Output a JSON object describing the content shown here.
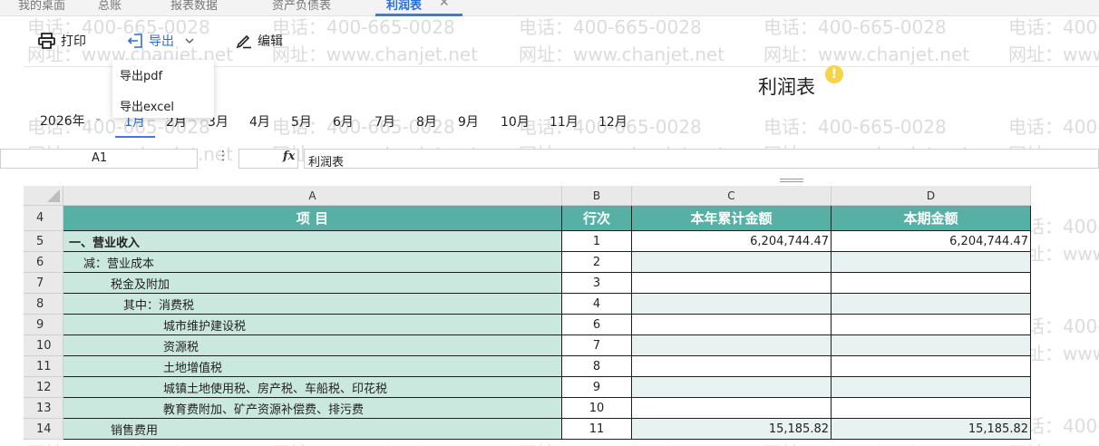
{
  "tabs": [
    {
      "label": "我的桌面",
      "active": false
    },
    {
      "label": "总账",
      "active": false
    },
    {
      "label": "报表数据",
      "active": false
    },
    {
      "label": "资产负债表",
      "active": false
    },
    {
      "label": "利润表",
      "active": true
    }
  ],
  "toolbar": {
    "print_label": "打印",
    "export_label": "导出",
    "edit_label": "编辑"
  },
  "export_menu": [
    "导出pdf",
    "导出excel"
  ],
  "report": {
    "title": "利润表",
    "warning_icon": "!"
  },
  "period": {
    "year": "2026年",
    "months": [
      "1月",
      "2月",
      "3月",
      "4月",
      "5月",
      "6月",
      "7月",
      "8月",
      "9月",
      "10月",
      "11月",
      "12月"
    ],
    "active_month": "1月"
  },
  "formula_bar": {
    "cell_ref": "A1",
    "content": "利润表",
    "fx_symbol": "fx"
  },
  "grid": {
    "columns": [
      "A",
      "B",
      "C",
      "D"
    ],
    "header_row": {
      "row": "4",
      "item": "项 目",
      "line_no": "行次",
      "ytd": "本年累计金额",
      "current": "本期金额"
    },
    "rows": [
      {
        "row": "5",
        "item": "一、营业收入",
        "line": "1",
        "ytd": "6,204,744.47",
        "current": "6,204,744.47"
      },
      {
        "row": "6",
        "item": "减：营业成本",
        "line": "2",
        "ytd": "",
        "current": ""
      },
      {
        "row": "7",
        "item": "税金及附加",
        "line": "3",
        "ytd": "",
        "current": ""
      },
      {
        "row": "8",
        "item": "其中：消费税",
        "line": "4",
        "ytd": "",
        "current": ""
      },
      {
        "row": "9",
        "item": "城市维护建设税",
        "line": "6",
        "ytd": "",
        "current": ""
      },
      {
        "row": "10",
        "item": "资源税",
        "line": "7",
        "ytd": "",
        "current": ""
      },
      {
        "row": "11",
        "item": "土地增值税",
        "line": "8",
        "ytd": "",
        "current": ""
      },
      {
        "row": "12",
        "item": "城镇土地使用税、房产税、车船税、印花税",
        "line": "9",
        "ytd": "",
        "current": ""
      },
      {
        "row": "13",
        "item": "教育费附加、矿产资源补偿费、排污费",
        "line": "10",
        "ytd": "",
        "current": ""
      },
      {
        "row": "14",
        "item": "销售费用",
        "line": "11",
        "ytd": "15,185.82",
        "current": "15,185.82"
      }
    ]
  },
  "watermark": {
    "phone": "电话：400-665-0028",
    "site": "网址：www.chanjet.net"
  },
  "colors": {
    "accent": "#2b6fd6",
    "header_teal": "#56b1a4",
    "item_green": "#cbe8de",
    "warning": "#f6d44a"
  },
  "icons": [
    "printer-icon",
    "export-icon",
    "chevron-down-icon",
    "edit-pen-icon",
    "warning-icon",
    "fx-icon"
  ]
}
